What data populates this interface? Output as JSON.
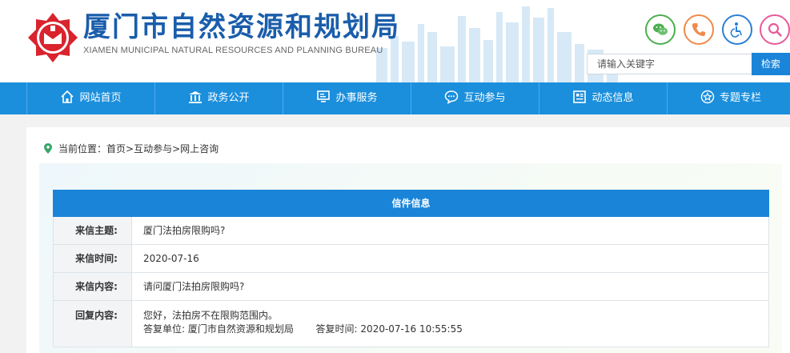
{
  "header": {
    "title_cn": "厦门市自然资源和规划局",
    "title_en": "XIAMEN MUNICIPAL NATURAL RESOURCES AND PLANNING BUREAU",
    "search_placeholder": "请输入关键字",
    "search_button": "检索",
    "tools": [
      "wechat-icon",
      "phone-icon",
      "accessibility-icon",
      "search-icon"
    ]
  },
  "nav": {
    "items": [
      {
        "label": "网站首页",
        "icon": "home-icon"
      },
      {
        "label": "政务公开",
        "icon": "government-building-icon"
      },
      {
        "label": "办事服务",
        "icon": "monitor-icon"
      },
      {
        "label": "互动参与",
        "icon": "chat-bubble-icon"
      },
      {
        "label": "动态信息",
        "icon": "newspaper-icon"
      },
      {
        "label": "专题专栏",
        "icon": "star-icon"
      }
    ]
  },
  "breadcrumb": {
    "prefix": "当前位置：",
    "path": "首页>互动参与>网上咨询"
  },
  "letter": {
    "heading": "信件信息",
    "subject_label": "来信主题:",
    "subject": "厦门法拍房限购吗?",
    "date_label": "来信时间:",
    "date": "2020-07-16",
    "content_label": "来信内容:",
    "content": "请问厦门法拍房限购吗?",
    "reply_label": "回复内容:",
    "reply": "您好，法拍房不在限购范围内。",
    "reply_unit_label": "答复单位:",
    "reply_unit": "厦门市自然资源和规划局",
    "reply_time_label": "答复时间:",
    "reply_time": "2020-07-16 10:55:55"
  },
  "colors": {
    "brand_blue": "#1a5dab",
    "nav_blue": "#1b8fdc",
    "table_head_blue": "#1a84d8",
    "logo_red": "#d9232d"
  }
}
